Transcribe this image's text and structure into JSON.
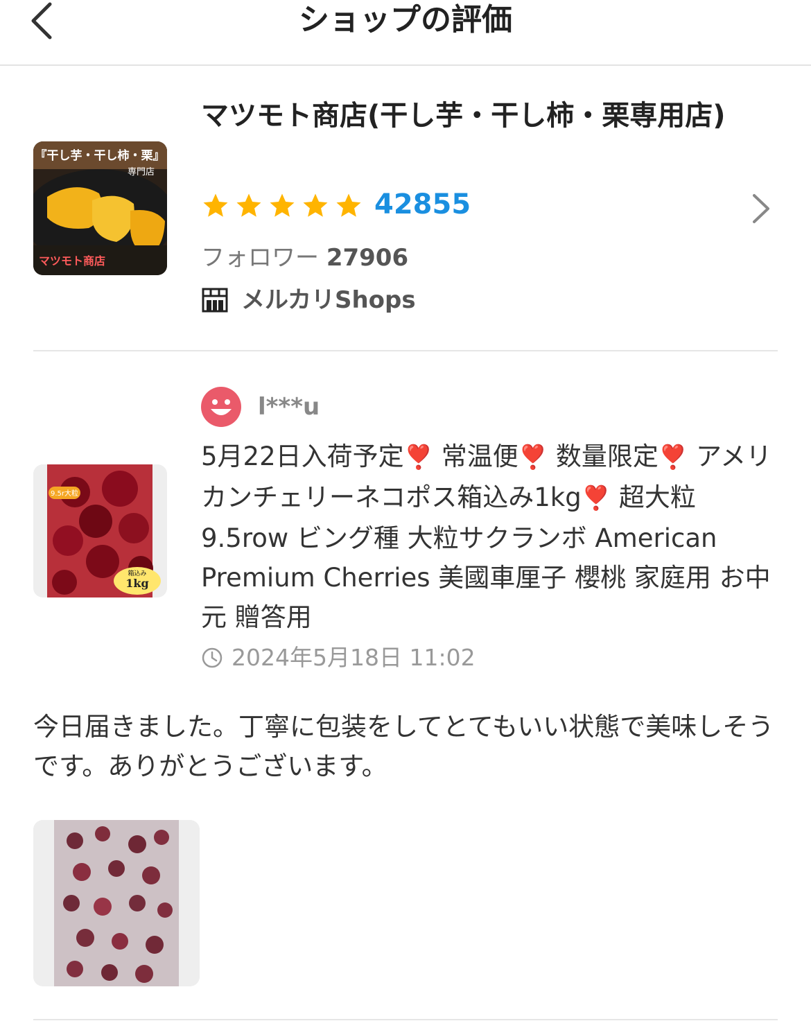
{
  "header": {
    "title": "ショップの評価"
  },
  "shop": {
    "name": "マツモト商店(干し芋・干し柿・栗専用店)",
    "thumb_texts": {
      "top_banner": "『干し芋・干し柿・栗』",
      "sub": "専門店",
      "brand": "マツモト商店"
    },
    "rating_stars": 5,
    "rating_count": "42855",
    "followers_label": "フォロワー",
    "followers_count": "27906",
    "badge_label": "メルカリShops",
    "accent_color": "#1a8fe0",
    "star_color": "#ffb400"
  },
  "review": {
    "username": "l***u",
    "product_title_parts": [
      "5月22日入荷予定",
      "常温便",
      "数量限定",
      "アメリカンチェリーネコポス箱込み1kg",
      "超大粒 9.5row ビング種 大粒サクランボ American Premium Cherries 美國車厘子 櫻桃 家庭用 お中元 贈答用"
    ],
    "heart_glyph": "❣️",
    "product_thumb_texts": {
      "size": "9.5r大粒",
      "box": "箱込み",
      "weight": "1kg"
    },
    "date": "2024年5月18日 11:02",
    "comment": "今日届きました。丁寧に包装をしてとてもいい状態で美味しそうです。ありがとうございます。",
    "avatar_color": "#ea5a6a"
  }
}
